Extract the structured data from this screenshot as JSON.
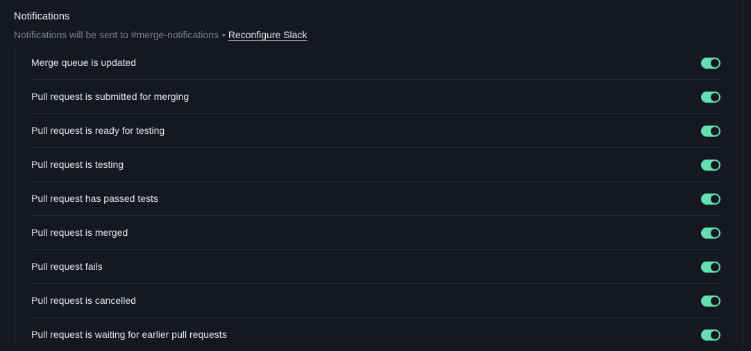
{
  "notifications": {
    "title": "Notifications",
    "subtitle_prefix": "Notifications will be sent to #merge-notifications",
    "subtitle_separator": "•",
    "reconfigure_link": "Reconfigure Slack",
    "accent_color": "#63e0b1",
    "items": [
      {
        "label": "Merge queue is updated",
        "enabled": "on"
      },
      {
        "label": "Pull request is submitted for merging",
        "enabled": "on"
      },
      {
        "label": "Pull request is ready for testing",
        "enabled": "on"
      },
      {
        "label": "Pull request is testing",
        "enabled": "on"
      },
      {
        "label": "Pull request has passed tests",
        "enabled": "on"
      },
      {
        "label": "Pull request is merged",
        "enabled": "on"
      },
      {
        "label": "Pull request fails",
        "enabled": "on"
      },
      {
        "label": "Pull request is cancelled",
        "enabled": "on"
      },
      {
        "label": "Pull request is waiting for earlier pull requests",
        "enabled": "on"
      }
    ]
  }
}
